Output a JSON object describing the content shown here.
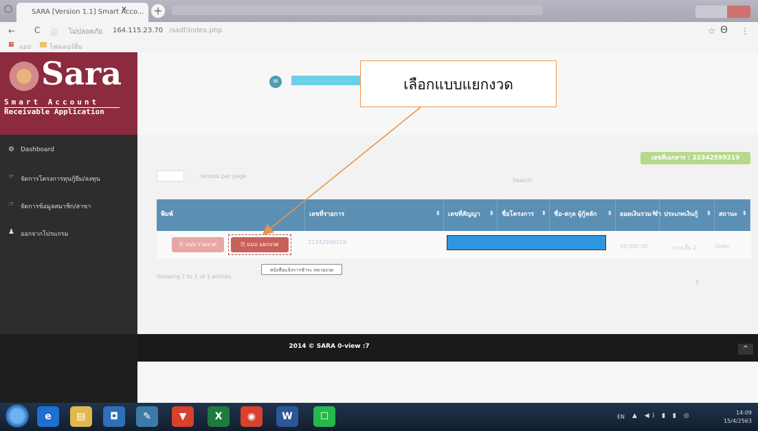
{
  "browser": {
    "tab_title": "SARA [Version 1.1] Smart Acco...",
    "tab_close": "×",
    "new_tab": "+",
    "back": "←",
    "reload": "C",
    "url_info": "ⓘ",
    "url_host": "ไม่ปลอดภัย",
    "url_ip": "164.115.23.70",
    "url_path": "/sadf/index.php",
    "bookmarks": [
      "แอป",
      "โฟลเดอร์อื่น"
    ]
  },
  "app": {
    "logo": "Sara",
    "logo_sub1": "Smart Account",
    "logo_sub2": "Receivable Application"
  },
  "sidebar": {
    "items": [
      {
        "icon": "⚙",
        "label": "Dashboard"
      },
      {
        "icon": "☞",
        "label": "จัดการโครงการทุนกู้ยืม/ลงทุน"
      },
      {
        "icon": "☞",
        "label": "จัดการข้อมูลสมาชิก/สาขา"
      },
      {
        "icon": "♟",
        "label": "ออกจากโปรแกรม"
      }
    ]
  },
  "content": {
    "doc_badge": "เลขที่เอกสาร : 22342599219",
    "records_label": "records per page",
    "search_label": "Search:",
    "table": {
      "headers": [
        "พิมพ์",
        "เลขที่รายการ",
        "เลขที่สัญญา",
        "ชื่อโครงการ",
        "ชื่อ-สกุล ผู้กู้หลัก",
        "ยอดเงินรวม ชำ",
        "ประเภทเงินกู้",
        "สถานะ"
      ],
      "row": {
        "btn_all": "⎘ แบบ รวมงวด",
        "btn_split": "⎘ แบบ แยกงวด",
        "doc_no": "22342599219",
        "amount": "00,000.00",
        "type": "ระยะสั้น 2",
        "status": "Open"
      }
    },
    "tooltip": "หนังสือแจ้งการชำระ หลายงวด",
    "showing": "Showing 1 to 1 of 1 entries",
    "page_num": "1"
  },
  "footer": {
    "text": "2014 © SARA 0-view :7",
    "scroll_top": "^"
  },
  "annotation": {
    "callout": "เลือกแบบแยกงวด",
    "color": "#e9964a"
  },
  "taskbar": {
    "apps": [
      {
        "icon": "ie-icon",
        "glyph": "e",
        "color": "#1f6fd1"
      },
      {
        "icon": "explorer-icon",
        "glyph": "▤",
        "color": "#e0b84e"
      },
      {
        "icon": "media-icon",
        "glyph": "◘",
        "color": "#2e6fb8"
      },
      {
        "icon": "paint-icon",
        "glyph": "✎",
        "color": "#3d7aa8"
      },
      {
        "icon": "brave-icon",
        "glyph": "▼",
        "color": "#d8412c"
      },
      {
        "icon": "excel-icon",
        "glyph": "X",
        "color": "#1f7a3d"
      },
      {
        "icon": "chrome-icon",
        "glyph": "◉",
        "color": "#d8412c"
      },
      {
        "icon": "word-icon",
        "glyph": "W",
        "color": "#2b579a"
      },
      {
        "icon": "line-icon",
        "glyph": "☐",
        "color": "#25b84c"
      }
    ],
    "lang": "EN",
    "tray": "▲ ◀) ▮ ▮ ◎",
    "time": "14:09",
    "date": "15/4/2563"
  }
}
